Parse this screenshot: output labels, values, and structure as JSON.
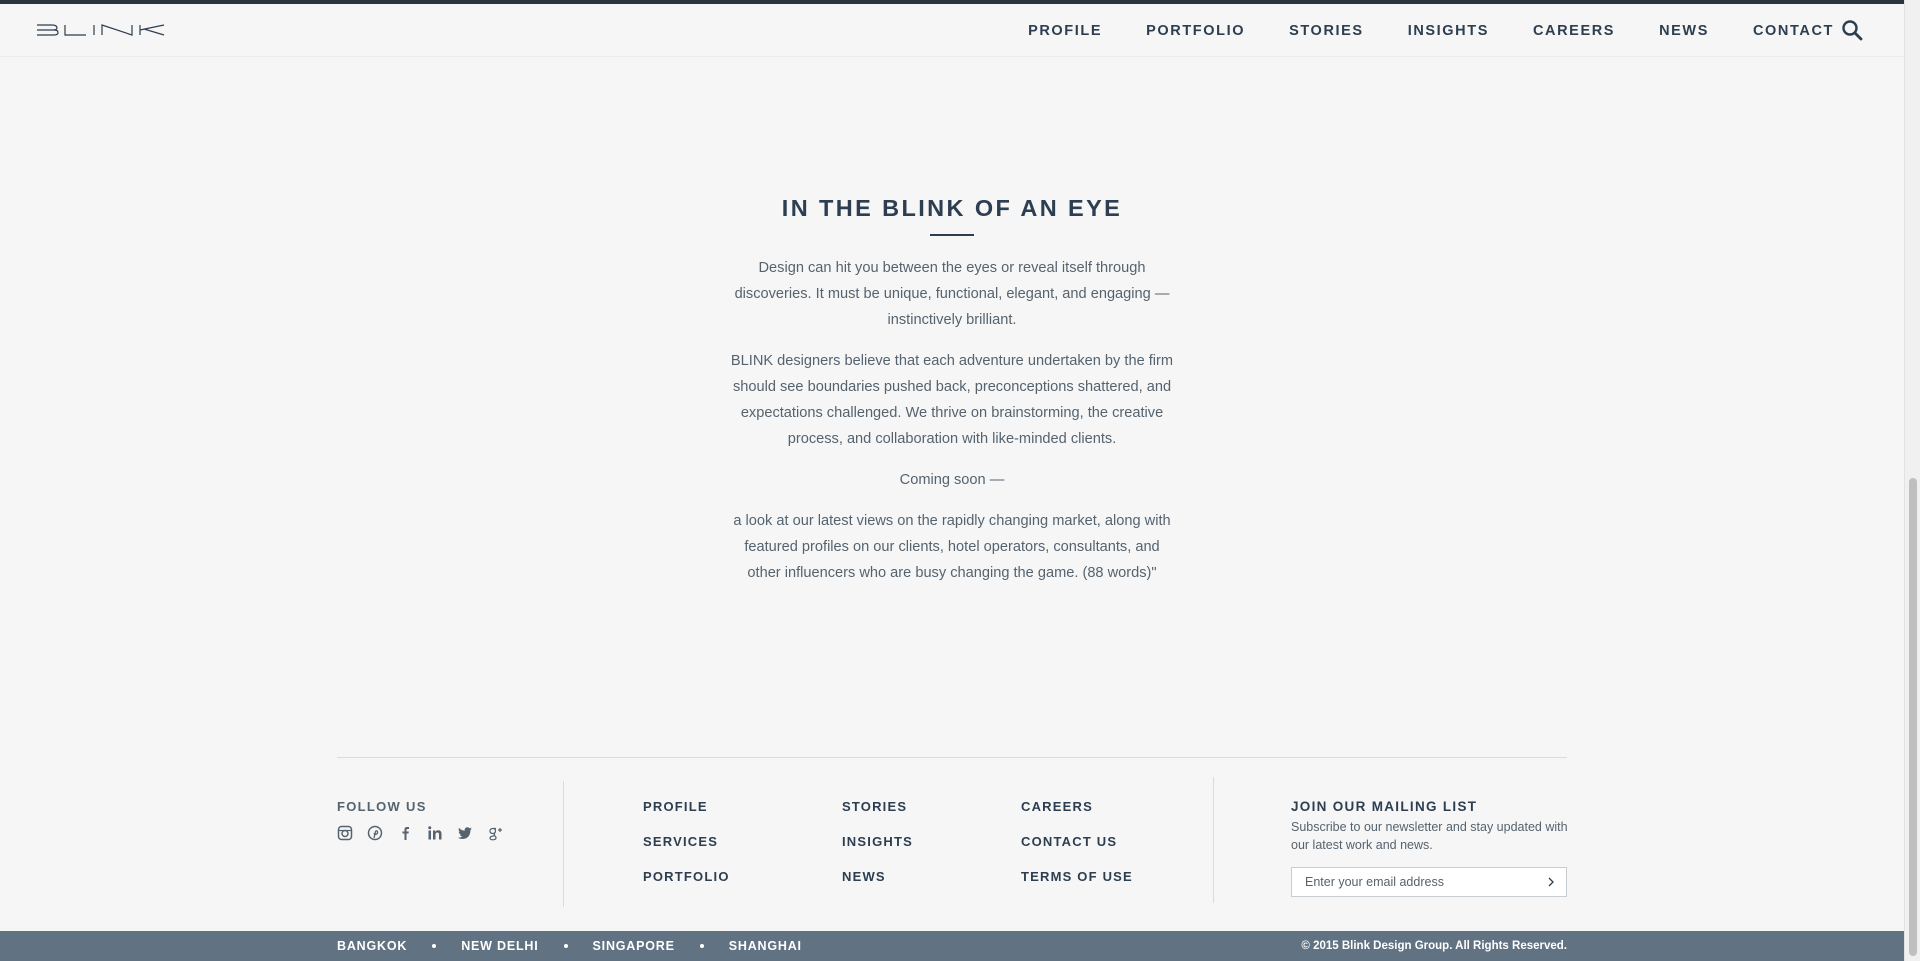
{
  "header": {
    "logo_text": "BLINK",
    "nav": [
      "PROFILE",
      "PORTFOLIO",
      "STORIES",
      "INSIGHTS",
      "CAREERS",
      "NEWS",
      "CONTACT"
    ],
    "search_icon": "search-icon"
  },
  "main": {
    "title": "IN THE BLINK OF AN EYE",
    "paragraphs": [
      "Design can hit you between the eyes or reveal itself through discoveries. It must be unique, functional, elegant, and engaging — instinctively brilliant.",
      "BLINK designers believe that each adventure undertaken by the firm should see boundaries pushed back, preconceptions shattered, and expectations challenged. We thrive on brainstorming, the creative process, and collaboration with like-minded clients.",
      "Coming soon —",
      "a look at our latest views on the rapidly changing market, along with featured profiles on our clients, hotel operators, consultants, and other influencers who are busy changing the game. (88 words)\""
    ]
  },
  "footer": {
    "follow_label": "FOLLOW US",
    "social_icons": [
      "instagram-icon",
      "pinterest-icon",
      "facebook-icon",
      "linkedin-icon",
      "twitter-icon",
      "google-plus-icon"
    ],
    "col1": [
      "PROFILE",
      "SERVICES",
      "PORTFOLIO"
    ],
    "col2": [
      "STORIES",
      "INSIGHTS",
      "NEWS"
    ],
    "col3": [
      "CAREERS",
      "CONTACT US",
      "TERMS OF USE"
    ],
    "mailing": {
      "title": "JOIN OUR MAILING LIST",
      "description": "Subscribe to our newsletter and stay updated with our latest work and news.",
      "placeholder": "Enter your email address"
    }
  },
  "bottom_bar": {
    "cities": [
      "BANGKOK",
      "NEW DELHI",
      "SINGAPORE",
      "SHANGHAI"
    ],
    "copyright": "© 2015 Blink Design Group. All Rights Reserved."
  },
  "colors": {
    "text_dark": "#2c3e50",
    "text_body": "#55636f",
    "bottom_bar": "#617282",
    "background": "#f6f6f6"
  }
}
